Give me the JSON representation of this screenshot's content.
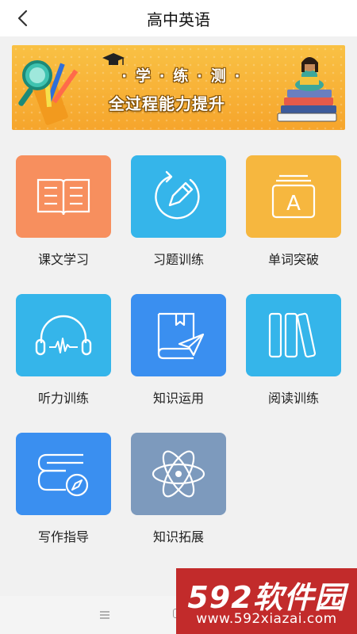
{
  "header": {
    "title": "高中英语",
    "back_icon": "chevron-left-icon"
  },
  "banner": {
    "line1": "· 学 · 练 · 测 ·",
    "line2": "全过程能力提升"
  },
  "tiles": [
    {
      "label": "课文学习",
      "icon": "open-book-icon",
      "color": "#f78f5e"
    },
    {
      "label": "习题训练",
      "icon": "pencil-circle-icon",
      "color": "#35b5ea"
    },
    {
      "label": "单词突破",
      "icon": "letter-card-icon",
      "color": "#f6b73f"
    },
    {
      "label": "听力训练",
      "icon": "headphones-icon",
      "color": "#35b5ea"
    },
    {
      "label": "知识运用",
      "icon": "book-plane-icon",
      "color": "#3a8ff0"
    },
    {
      "label": "阅读训练",
      "icon": "bookshelf-icon",
      "color": "#35b5ea"
    },
    {
      "label": "写作指导",
      "icon": "compass-doc-icon",
      "color": "#3a8ff0"
    },
    {
      "label": "知识拓展",
      "icon": "atom-icon",
      "color": "#7d9abd"
    }
  ],
  "navbar": {
    "menu_icon": "hamburger-icon",
    "home_icon": "home-square-icon"
  },
  "watermark": {
    "main": "592软件园",
    "sub": "www.592xiazai.com"
  }
}
